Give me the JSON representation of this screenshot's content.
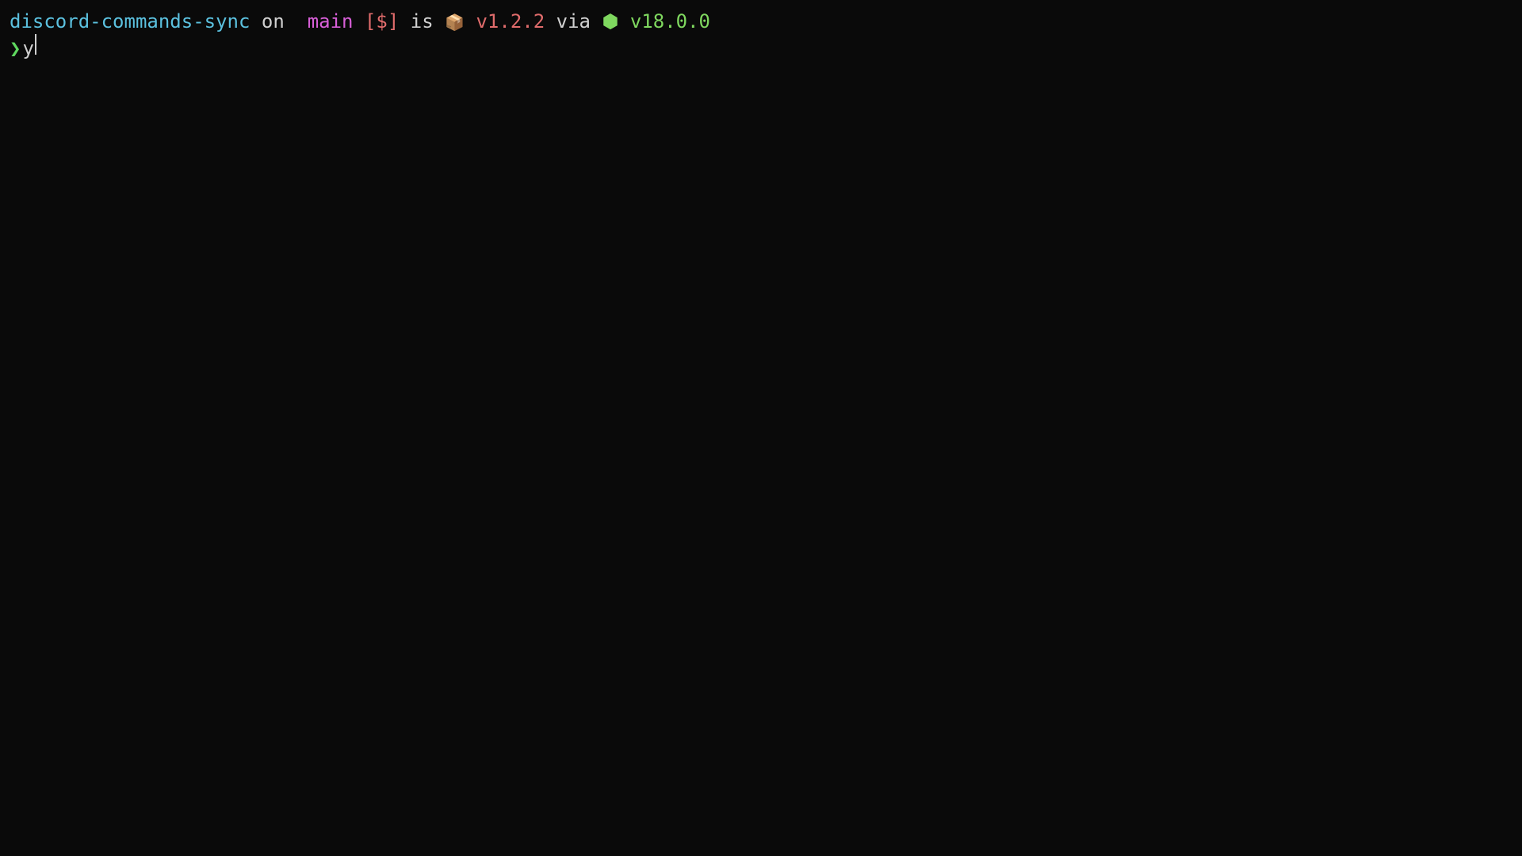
{
  "prompt": {
    "directory": "discord-commands-sync",
    "on_word": "on",
    "branch_icon": "",
    "branch": "main",
    "git_status_open": "[",
    "git_status_symbol": "$",
    "git_status_close": "]",
    "is_word": "is",
    "package_icon": "📦",
    "package_version": "v1.2.2",
    "via_word": "via",
    "node_icon": "⬢",
    "node_version": "v18.0.0"
  },
  "input": {
    "arrow": "❯",
    "typed": "y"
  }
}
